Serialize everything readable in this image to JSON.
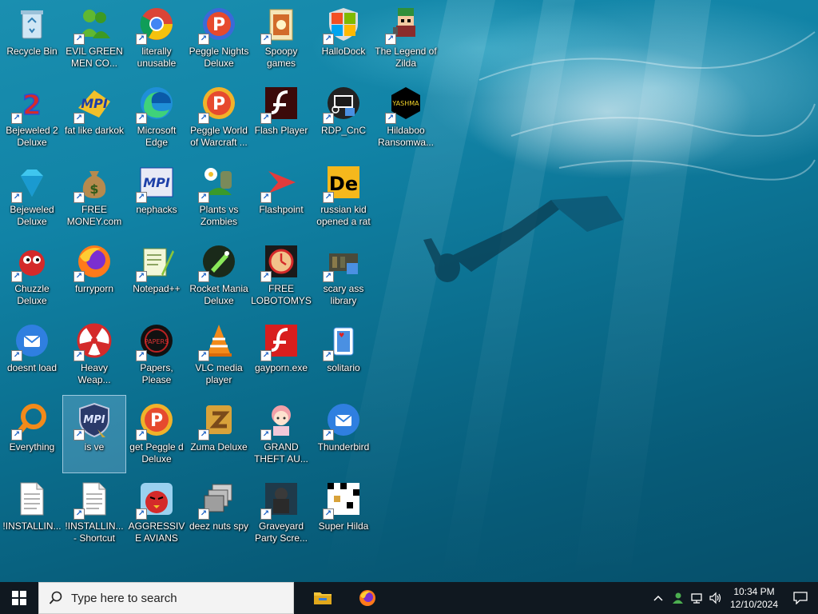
{
  "desktop": {
    "icons": [
      {
        "label": "Recycle Bin",
        "icon": "recycle-bin-icon",
        "shortcut": false
      },
      {
        "label": "EVIL GREEN MEN CO...",
        "icon": "messenger-icon",
        "shortcut": true
      },
      {
        "label": "literally unusable",
        "icon": "chrome-icon",
        "shortcut": true
      },
      {
        "label": "Peggle Nights Deluxe",
        "icon": "peggle-nights-icon",
        "shortcut": true
      },
      {
        "label": "Spoopy games",
        "icon": "folder-icon",
        "shortcut": true
      },
      {
        "label": "HalloDock",
        "icon": "windows-shield-icon",
        "shortcut": true
      },
      {
        "label": "The Legend of Zilda",
        "icon": "pixel-character-icon",
        "shortcut": true
      },
      {
        "label": "Bejeweled 2 Deluxe",
        "icon": "bejeweled2-icon",
        "shortcut": true
      },
      {
        "label": "fat like darkok",
        "icon": "mpi-icon",
        "shortcut": true
      },
      {
        "label": "Microsoft Edge",
        "icon": "edge-icon",
        "shortcut": true
      },
      {
        "label": "Peggle World of Warcraft ...",
        "icon": "peggle-icon",
        "shortcut": true
      },
      {
        "label": "Flash Player",
        "icon": "flash-dark-icon",
        "shortcut": true
      },
      {
        "label": "RDP_CnC",
        "icon": "rdp-icon",
        "shortcut": true
      },
      {
        "label": "Hildaboo Ransomwa...",
        "icon": "yashma-icon",
        "shortcut": true
      },
      {
        "label": "Bejeweled Deluxe",
        "icon": "diamond-icon",
        "shortcut": true
      },
      {
        "label": "FREE MONEY.com",
        "icon": "money-bag-icon",
        "shortcut": true
      },
      {
        "label": "nephacks",
        "icon": "mpi-box-icon",
        "shortcut": true
      },
      {
        "label": "Plants vs Zombies",
        "icon": "plants-icon",
        "shortcut": true
      },
      {
        "label": "Flashpoint",
        "icon": "flashpoint-icon",
        "shortcut": true
      },
      {
        "label": "russian kid opened a rat",
        "icon": "de-icon",
        "shortcut": true
      },
      {
        "label": "Chuzzle Deluxe",
        "icon": "chuzzle-icon",
        "shortcut": true
      },
      {
        "label": "furryporn",
        "icon": "firefox-icon",
        "shortcut": true
      },
      {
        "label": "Notepad++",
        "icon": "notepad-icon",
        "shortcut": true
      },
      {
        "label": "Rocket Mania Deluxe",
        "icon": "rocket-icon",
        "shortcut": true
      },
      {
        "label": "FREE LOBOTOMYS",
        "icon": "clock-icon",
        "shortcut": true
      },
      {
        "label": "scary ass library",
        "icon": "library-icon",
        "shortcut": true
      },
      {
        "label": "doesnt load",
        "icon": "thunderbird-icon",
        "shortcut": true
      },
      {
        "label": "Heavy Weap...",
        "icon": "radiation-icon",
        "shortcut": true
      },
      {
        "label": "Papers, Please",
        "icon": "papers-icon",
        "shortcut": true
      },
      {
        "label": "VLC media player",
        "icon": "vlc-icon",
        "shortcut": true
      },
      {
        "label": "gayporn.exe",
        "icon": "flash-red-icon",
        "shortcut": true
      },
      {
        "label": "solitario",
        "icon": "solitaire-icon",
        "shortcut": true
      },
      {
        "label": "Everything",
        "icon": "search-ring-icon",
        "shortcut": true
      },
      {
        "label": "is ve",
        "icon": "mpi-shield-icon",
        "shortcut": true,
        "selected": true
      },
      {
        "label": "get Peggle d Deluxe",
        "icon": "peggle-icon",
        "shortcut": true
      },
      {
        "label": "Zuma Deluxe",
        "icon": "zuma-icon",
        "shortcut": true
      },
      {
        "label": "GRAND THEFT AU...",
        "icon": "anime-girl-icon",
        "shortcut": true
      },
      {
        "label": "Thunderbird",
        "icon": "thunderbird-icon",
        "shortcut": true
      },
      {
        "label": "!INSTALLIN...",
        "icon": "document-icon",
        "shortcut": false
      },
      {
        "label": "!INSTALLIN... - Shortcut",
        "icon": "document-icon",
        "shortcut": true
      },
      {
        "label": "AGGRESSIVE AVIANS",
        "icon": "angry-bird-icon",
        "shortcut": true
      },
      {
        "label": "deez nuts spy",
        "icon": "windows-stack-icon",
        "shortcut": true
      },
      {
        "label": "Graveyard Party Scre...",
        "icon": "graveyard-icon",
        "shortcut": true
      },
      {
        "label": "Super Hilda",
        "icon": "pixel-map-icon",
        "shortcut": true
      }
    ]
  },
  "taskbar": {
    "search_placeholder": "Type here to search",
    "clock_time": "10:34 PM",
    "clock_date": "12/10/2024",
    "pinned": [
      {
        "name": "file-explorer-icon"
      },
      {
        "name": "firefox-icon"
      }
    ]
  },
  "colors": {
    "taskbar": "#101820",
    "search_bg": "#f3f3f3",
    "water_top": "#1a8fb0",
    "water_bottom": "#064f6a"
  }
}
